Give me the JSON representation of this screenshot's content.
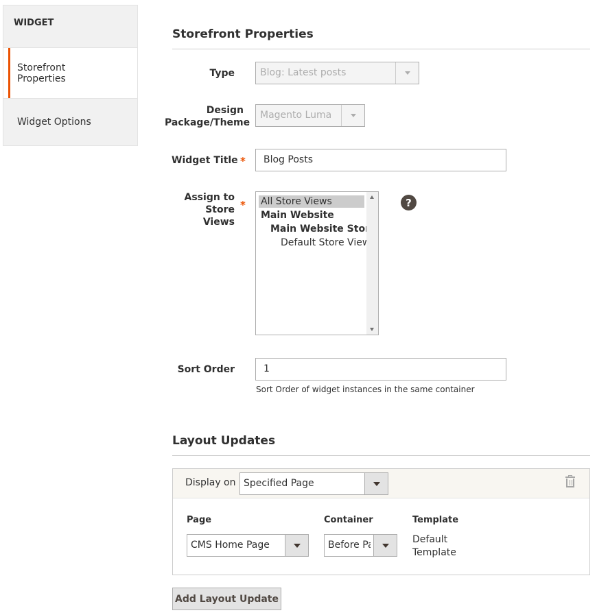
{
  "sidebar": {
    "header": "WIDGET",
    "items": [
      {
        "label": "Storefront Properties",
        "active": true
      },
      {
        "label": "Widget Options",
        "active": false
      }
    ]
  },
  "storefront": {
    "title": "Storefront Properties",
    "type": {
      "label": "Type",
      "value": "Blog: Latest posts"
    },
    "design": {
      "label": "Design Package/Theme",
      "value": "Magento Luma"
    },
    "widget_title": {
      "label": "Widget Title",
      "value": "Blog Posts",
      "required": true
    },
    "store_views": {
      "label": "Assign to Store Views",
      "required": true,
      "options": [
        {
          "label": "All Store Views",
          "selected": true,
          "bold": false,
          "indent": 0
        },
        {
          "label": "Main Website",
          "selected": false,
          "bold": true,
          "indent": 0
        },
        {
          "label": "Main Website Store",
          "selected": false,
          "bold": true,
          "indent": 1
        },
        {
          "label": "Default Store View",
          "selected": false,
          "bold": false,
          "indent": 2
        }
      ],
      "help": "?"
    },
    "sort_order": {
      "label": "Sort Order",
      "value": "1",
      "note": "Sort Order of widget instances in the same container"
    }
  },
  "layout_updates": {
    "title": "Layout Updates",
    "display_on_label": "Display on",
    "display_on_value": "Specified Page",
    "columns": {
      "page": "Page",
      "container": "Container",
      "template": "Template"
    },
    "page_value": "CMS Home Page",
    "container_value": "Before Page Footer",
    "template_value": "Default Template",
    "add_button": "Add Layout Update"
  },
  "colors": {
    "accent": "#eb5202",
    "sidebar_bg": "#f1f1f1",
    "layout_head_bg": "#f8f6f1"
  }
}
